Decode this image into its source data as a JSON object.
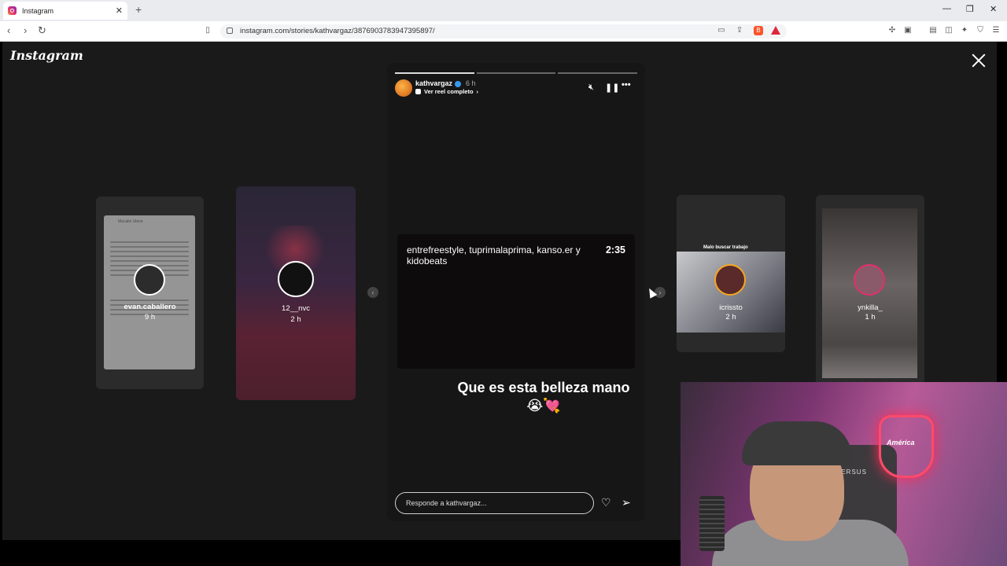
{
  "browser": {
    "tab_title": "Instagram",
    "tab_close": "✕",
    "new_tab": "+",
    "url": "instagram.com/stories/kathvargaz/3876903783947395897/",
    "controls": {
      "minimize": "—",
      "maximize": "❐",
      "close": "✕"
    }
  },
  "page": {
    "logo": "Instagram",
    "previews": [
      {
        "username": "evan.caballero",
        "time": "9 h"
      },
      {
        "username": "12__nvc",
        "time": "2 h"
      },
      {
        "username": "icrissto",
        "time": "2 h"
      },
      {
        "username": "ynkilla_",
        "time": "1 h"
      }
    ],
    "preview_card_header": "Macalio Ulene",
    "preview_p3_header": "Malo buscar trabajo"
  },
  "story": {
    "username": "kathvargaz",
    "time": "6 h",
    "reel_link": "Ver reel completo",
    "progress": {
      "segments": 3,
      "active": 1
    },
    "video_title": "entrefreestyle, tuprimalaprima, kanso.er y kidobeats",
    "video_duration": "2:35",
    "caption": "Que es esta belleza mano 😭💘",
    "reply_placeholder": "Responde a kathvargaz..."
  },
  "webcam": {
    "neon_sign": "América",
    "chair_text": "VERSUS"
  },
  "colors": {
    "stage_bg": "#1a1a1a",
    "accent_verified": "#3897f0"
  }
}
